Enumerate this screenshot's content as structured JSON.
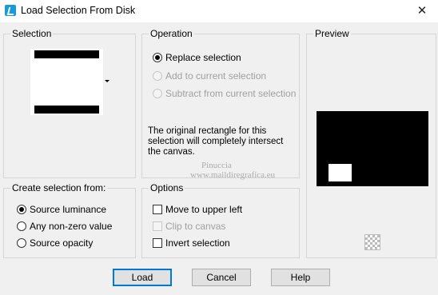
{
  "window": {
    "title": "Load Selection From Disk",
    "close_glyph": "✕"
  },
  "selection": {
    "title": "Selection"
  },
  "operation": {
    "title": "Operation",
    "options": [
      {
        "label": "Replace selection",
        "selected": true,
        "enabled": true
      },
      {
        "label": "Add to current selection",
        "selected": false,
        "enabled": false
      },
      {
        "label": "Subtract from current selection",
        "selected": false,
        "enabled": false
      }
    ],
    "info": "The original rectangle for this selection will completely intersect the canvas."
  },
  "preview": {
    "title": "Preview"
  },
  "create_from": {
    "title": "Create selection from:",
    "options": [
      {
        "label": "Source luminance",
        "selected": true
      },
      {
        "label": "Any non-zero value",
        "selected": false
      },
      {
        "label": "Source opacity",
        "selected": false
      }
    ]
  },
  "options": {
    "title": "Options",
    "items": [
      {
        "label": "Move to upper left",
        "checked": false,
        "enabled": true
      },
      {
        "label": "Clip to canvas",
        "checked": false,
        "enabled": false
      },
      {
        "label": "Invert selection",
        "checked": false,
        "enabled": true
      }
    ]
  },
  "buttons": {
    "load": "Load",
    "cancel": "Cancel",
    "help": "Help"
  },
  "watermark": {
    "name": "Pinuccia",
    "url": "www.maildiregrafica.eu"
  },
  "colors": {
    "accent": "#0078d7",
    "icon": "#1a9bd7"
  }
}
